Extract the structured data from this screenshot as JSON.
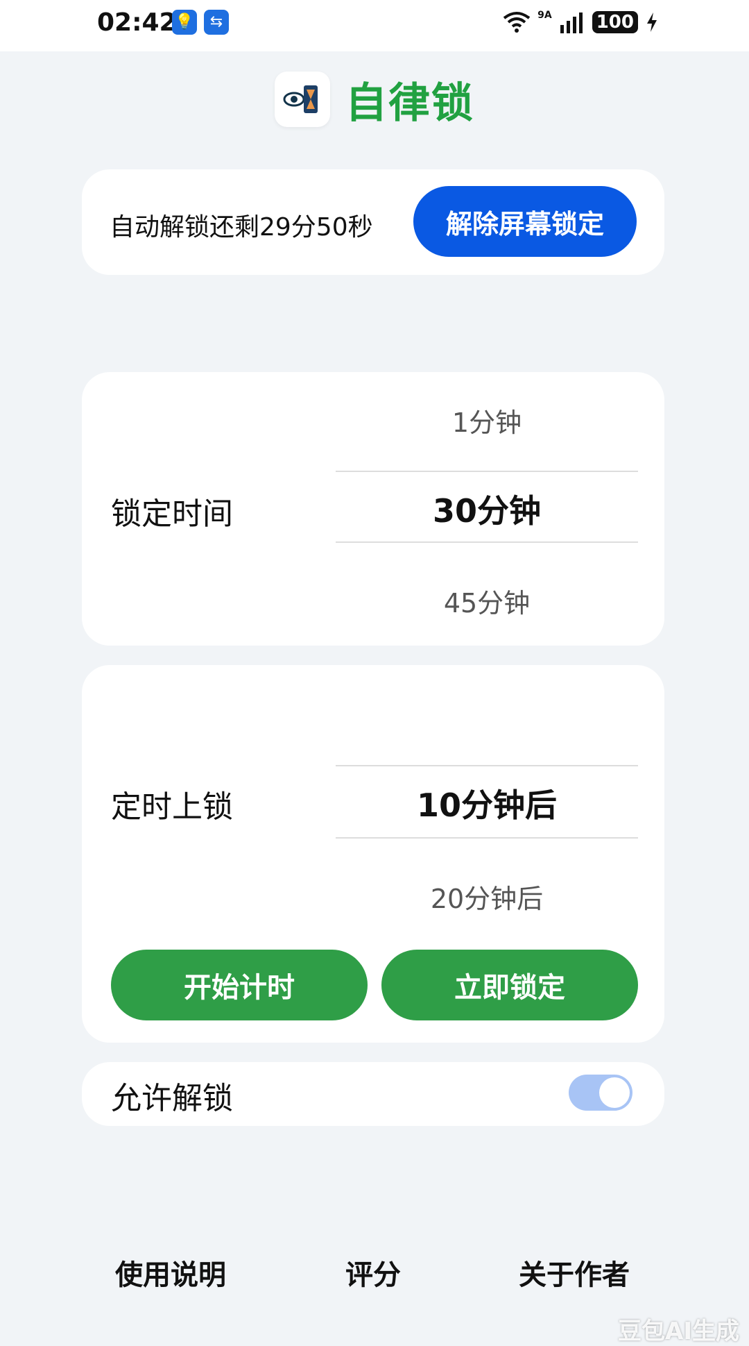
{
  "status_bar": {
    "time": "02:42",
    "app_icons": [
      "bulb-app-icon",
      "transfer-app-icon"
    ],
    "network": "9A",
    "battery": "100"
  },
  "header": {
    "app_name": "自律锁"
  },
  "countdown": {
    "text": "自动解锁还剩29分50秒",
    "unlock_button": "解除屏幕锁定"
  },
  "lock_duration": {
    "label": "锁定时间",
    "options": [
      "1分钟",
      "30分钟",
      "45分钟"
    ],
    "selected": "30分钟"
  },
  "scheduled_lock": {
    "label": "定时上锁",
    "options": [
      "10分钟后",
      "20分钟后"
    ],
    "selected": "10分钟后",
    "start_button": "开始计时",
    "lock_now_button": "立即锁定"
  },
  "allow_unlock": {
    "label": "允许解锁",
    "enabled": true
  },
  "bottom_nav": {
    "instructions": "使用说明",
    "rate": "评分",
    "about": "关于作者"
  },
  "watermark": "豆包AI生成",
  "colors": {
    "brand_green": "#21a141",
    "primary_blue": "#0a59e3",
    "button_green": "#2f9e47",
    "toggle_on": "#a8c4f5",
    "background": "#f1f4f7"
  }
}
